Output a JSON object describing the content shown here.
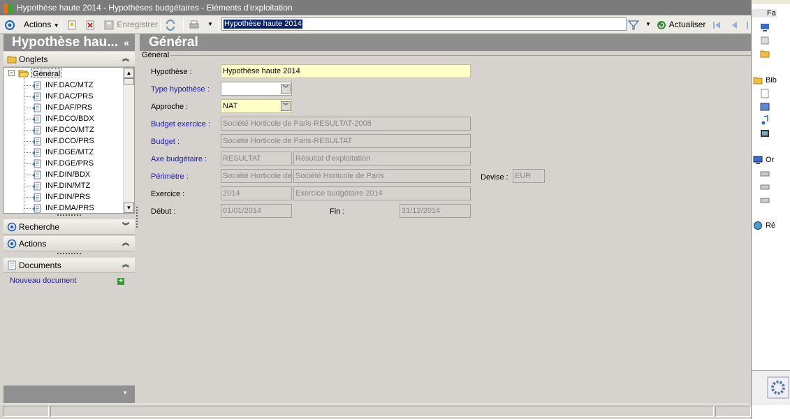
{
  "window": {
    "title": "Hypothèse haute 2014 -  Hypothèses budgétaires - Eléments d'exploitation"
  },
  "toolbar": {
    "actions_label": "Actions",
    "save_label": "Enregistrer",
    "search_value": "Hypothèse haute 2014",
    "refresh_label": "Actualiser"
  },
  "left_panel": {
    "title": "Hypothèse hau...",
    "tabs_section": "Onglets",
    "tree_root": "Général",
    "tree_items": [
      "INF.DAC/MTZ",
      "INF.DAC/PRS",
      "INF.DAF/PRS",
      "INF.DCO/BDX",
      "INF.DCO/MTZ",
      "INF.DCO/PRS",
      "INF.DGE/MTZ",
      "INF.DGE/PRS",
      "INF.DIN/BDX",
      "INF.DIN/MTZ",
      "INF.DIN/PRS",
      "INF.DMA/PRS"
    ],
    "search_section": "Recherche",
    "actions_section": "Actions",
    "documents_section": "Documents",
    "new_document": "Nouveau document"
  },
  "main": {
    "title": "Général",
    "group_label": "Général",
    "fields": {
      "hypothese_label": "Hypothèse :",
      "hypothese_value": "Hypothèse haute 2014",
      "type_label": "Type hypothèse :",
      "type_value": "",
      "approche_label": "Approche :",
      "approche_value": "NAT",
      "budget_exercice_label": "Budget exercice :",
      "budget_exercice_value": "Société Horticole de Paris-RESULTAT-2008",
      "budget_label": "Budget :",
      "budget_value": "Société Horticole de Paris-RESULTAT",
      "axe_label": "Axe budgétaire :",
      "axe_code": "RESULTAT",
      "axe_value": "Résultat d'exploitation",
      "perimetre_label": "Périmètre :",
      "perimetre_code": "Société Horticole de",
      "perimetre_value": "Société Horticole de Paris",
      "devise_label": "Devise :",
      "devise_value": "EUR",
      "exercice_label": "Exercice :",
      "exercice_code": "2014",
      "exercice_value": "Exercice budgétaire 2014",
      "debut_label": "Début :",
      "debut_value": "01/01/2014",
      "fin_label": "Fin :",
      "fin_value": "31/12/2014"
    }
  },
  "right_pane": {
    "items": [
      "Fa",
      "Bib",
      "Or",
      "Ré"
    ]
  },
  "colors": {
    "header_gray": "#8e8e8e",
    "editable_yellow": "#ffffc8",
    "link_blue": "#1a1ab0"
  }
}
